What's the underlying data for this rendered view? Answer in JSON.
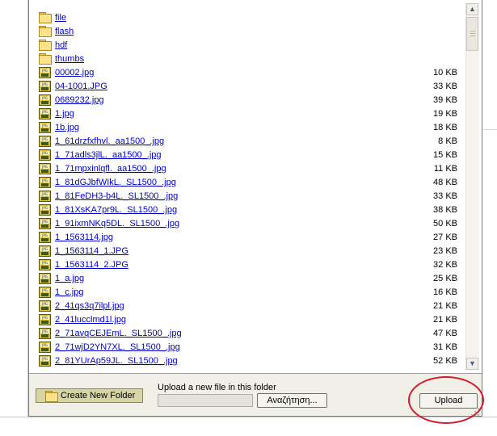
{
  "files": [
    {
      "type": "folder",
      "name": "file",
      "size": ""
    },
    {
      "type": "folder",
      "name": "flash",
      "size": ""
    },
    {
      "type": "folder",
      "name": "hdf",
      "size": ""
    },
    {
      "type": "folder",
      "name": "thumbs",
      "size": ""
    },
    {
      "type": "jpg",
      "name": "00002.jpg",
      "size": "10 KB"
    },
    {
      "type": "jpg",
      "name": "04-1001.JPG",
      "size": "33 KB"
    },
    {
      "type": "jpg",
      "name": "0689232.jpg",
      "size": "39 KB"
    },
    {
      "type": "jpg",
      "name": "1.jpg",
      "size": "19 KB"
    },
    {
      "type": "jpg",
      "name": "1b.jpg",
      "size": "18 KB"
    },
    {
      "type": "jpg",
      "name": "1_61drzfxfhvl._aa1500_.jpg",
      "size": "8 KB"
    },
    {
      "type": "jpg",
      "name": "1_71adls3jlL._aa1500_.jpg",
      "size": "15 KB"
    },
    {
      "type": "jpg",
      "name": "1_71mpxinlqfl._aa1500_.jpg",
      "size": "11 KB"
    },
    {
      "type": "jpg",
      "name": "1_81dGJbfWIkL._SL1500_.jpg",
      "size": "48 KB"
    },
    {
      "type": "jpg",
      "name": "1_81FeDH3-b4L._SL1500_.jpg",
      "size": "33 KB"
    },
    {
      "type": "jpg",
      "name": "1_81XsKA7pr9L._SL1500_.jpg",
      "size": "38 KB"
    },
    {
      "type": "jpg",
      "name": "1_91ixmNKq5DL._SL1500_.jpg",
      "size": "50 KB"
    },
    {
      "type": "jpg",
      "name": "1_1563114.jpg",
      "size": "27 KB"
    },
    {
      "type": "jpg",
      "name": "1_1563114_1.JPG",
      "size": "23 KB"
    },
    {
      "type": "jpg",
      "name": "1_1563114_2.JPG",
      "size": "32 KB"
    },
    {
      "type": "jpg",
      "name": "1_a.jpg",
      "size": "25 KB"
    },
    {
      "type": "jpg",
      "name": "1_c.jpg",
      "size": "16 KB"
    },
    {
      "type": "jpg",
      "name": "2_41qs3q7ilpl.jpg",
      "size": "21 KB"
    },
    {
      "type": "jpg",
      "name": "2_41lucclmd1l.jpg",
      "size": "21 KB"
    },
    {
      "type": "jpg",
      "name": "2_71avqCEJEmL._SL1500_.jpg",
      "size": "47 KB"
    },
    {
      "type": "jpg",
      "name": "2_71wjD2YN7XL._SL1500_.jpg",
      "size": "31 KB"
    },
    {
      "type": "jpg",
      "name": "2_81YUrAp59JL._SL1500_.jpg",
      "size": "52 KB"
    }
  ],
  "toolbar": {
    "create_folder_label": "Create New Folder",
    "upload_prompt": "Upload a new file in this folder",
    "file_path_value": "",
    "browse_label": "Αναζήτηση...",
    "upload_label": "Upload"
  },
  "icons": {
    "folder": "folder-icon",
    "jpg": "jpg-file-icon",
    "scroll_up": "scroll-up-arrow-icon",
    "scroll_down": "scroll-down-arrow-icon",
    "resize": "resize-grip-icon"
  },
  "colors": {
    "link": "#0000cc",
    "highlight": "#d21a2a",
    "folder_button_bg": "#d6d4a5",
    "panel_bg": "#f0efe8"
  },
  "scroll": {
    "position_fraction": 0.0,
    "visible_fraction": 0.09
  }
}
